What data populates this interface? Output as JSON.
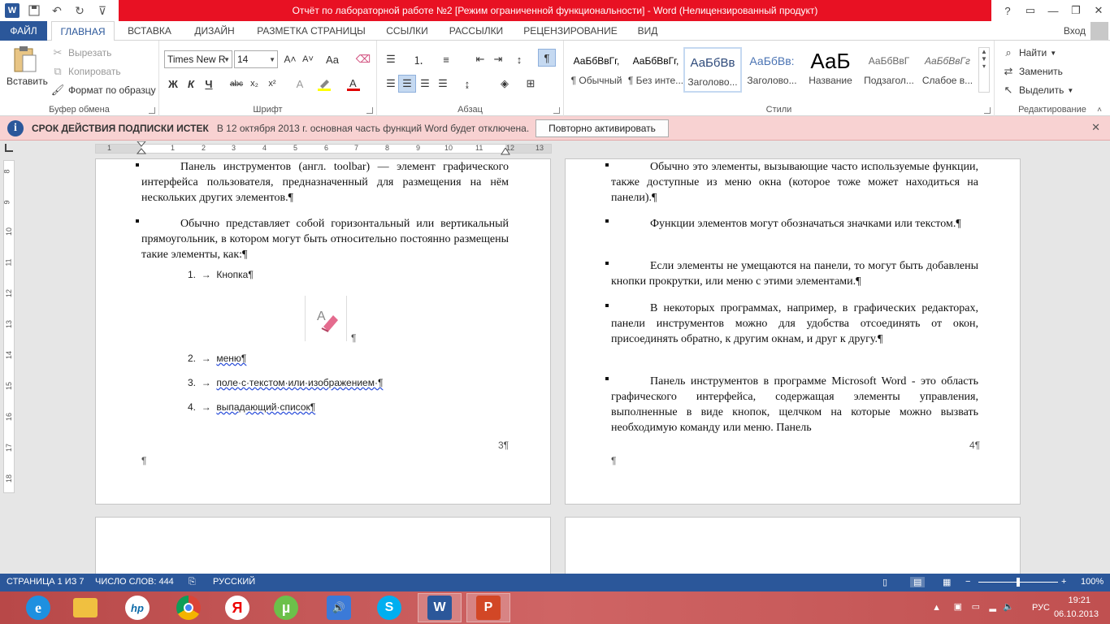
{
  "window": {
    "title": "Отчёт по лабораторной работе №2 [Режим ограниченной функциональности] -  Word (Нелицензированный продукт)",
    "controls": [
      "?",
      "▭",
      "—",
      "❐",
      "✕"
    ]
  },
  "qat": {
    "icons": [
      "word-logo",
      "save-icon",
      "undo-icon",
      "redo-icon",
      "customize-icon"
    ]
  },
  "tabs": {
    "file": "ФАЙЛ",
    "items": [
      "ГЛАВНАЯ",
      "ВСТАВКА",
      "ДИЗАЙН",
      "РАЗМЕТКА СТРАНИЦЫ",
      "ССЫЛКИ",
      "РАССЫЛКИ",
      "РЕЦЕНЗИРОВАНИЕ",
      "ВИД"
    ],
    "login": "Вход"
  },
  "clipboard": {
    "paste": "Вставить",
    "cut": "Вырезать",
    "copy": "Копировать",
    "format_painter": "Формат по образцу",
    "label": "Буфер обмена"
  },
  "font": {
    "name": "Times New R",
    "size": "14",
    "label": "Шрифт",
    "bold": "Ж",
    "italic": "К",
    "underline": "Ч",
    "strike": "abc",
    "sub": "x₂",
    "sup": "x²",
    "grow": "A˄",
    "shrink": "A˅",
    "case": "Aa"
  },
  "paragraph": {
    "label": "Абзац"
  },
  "styles": {
    "label": "Стили",
    "items": [
      {
        "preview": "АаБбВвГг,",
        "name": "¶ Обычный"
      },
      {
        "preview": "АаБбВвГг,",
        "name": "¶ Без инте..."
      },
      {
        "preview": "АаБбВв",
        "name": "Заголово..."
      },
      {
        "preview": "АаБбВв:",
        "name": "Заголово..."
      },
      {
        "preview": "АаБ",
        "name": "Название"
      },
      {
        "preview": "АаБбВвГ",
        "name": "Подзагол..."
      },
      {
        "preview": "АаБбВвГг",
        "name": "Слабое в..."
      }
    ]
  },
  "editing": {
    "find": "Найти",
    "replace": "Заменить",
    "select": "Выделить",
    "label": "Редактирование"
  },
  "notification": {
    "title": "СРОК ДЕЙСТВИЯ ПОДПИСКИ ИСТЕК",
    "text": "В 12 октября 2013 г. основная часть функций Word будет отключена.",
    "button": "Повторно активировать",
    "close": "✕"
  },
  "ruler": {
    "h": [
      "1",
      "1",
      "2",
      "3",
      "4",
      "5",
      "6",
      "7",
      "8",
      "9",
      "10",
      "11",
      "12",
      "13"
    ],
    "v": [
      "8",
      "9",
      "10",
      "11",
      "12",
      "13",
      "14",
      "15",
      "16",
      "17",
      "18"
    ]
  },
  "page3": {
    "p1": "Панель инструментов (англ. toolbar) — элемент графического интерфейса пользователя, предназначенный для размещения на нём нескольких других элементов.¶",
    "p2": "Обычно представляет собой горизонтальный или вертикальный прямоугольник, в котором могут быть относительно постоянно размещены такие элементы, как:¶",
    "list": [
      {
        "num": "1.",
        "text": "Кнопка¶"
      },
      {
        "num": "2.",
        "text": "меню¶"
      },
      {
        "num": "3.",
        "text": "поле·с·текстом·или·изображением·¶"
      },
      {
        "num": "4.",
        "text": "выпадающий·список¶"
      }
    ],
    "arrow": "→",
    "image_pilcrow": "¶",
    "page_num": "3¶",
    "end_mark": "¶"
  },
  "page4": {
    "p1": "Обычно это элементы, вызывающие часто используемые функции, также доступные из меню окна (которое тоже может находиться на панели).¶",
    "p2": "Функции элементов могут обозначаться значками или текстом.¶",
    "p3": "Если элементы не умещаются на панели, то могут быть добавлены кнопки прокрутки, или меню с этими элементами.¶",
    "p4": "В некоторых программах, например, в графических редакторах, панели инструментов можно для удобства отсоединять от окон, присоединять обратно, к другим окнам, и друг к другу.¶",
    "p5": "Панель инструментов в программе Microsoft Word - это область графического интерфейса, содержащая элементы управления, выполненные в виде кнопок, щелчком на которые можно вызвать необходимую команду или меню. Панель",
    "page_num": "4¶",
    "end_mark": "¶"
  },
  "status": {
    "page": "СТРАНИЦА 1 ИЗ 7",
    "words": "ЧИСЛО СЛОВ: 444",
    "lang": "РУССКИЙ",
    "zoom": "100%",
    "zoom_level": 0.5
  },
  "taskbar": {
    "apps": [
      "ie-icon",
      "explorer-icon",
      "hp-icon",
      "chrome-icon",
      "yandex-icon",
      "utorrent-icon",
      "speaker-app-icon",
      "skype-icon",
      "word-icon",
      "powerpoint-icon"
    ],
    "labels": {
      "hp": "hp",
      "yandex": "Я",
      "utorrent": "µ",
      "skype": "S",
      "word": "W",
      "ppt": "P"
    },
    "lang": "РУС",
    "time": "19:21",
    "date": "06.10.2013"
  }
}
